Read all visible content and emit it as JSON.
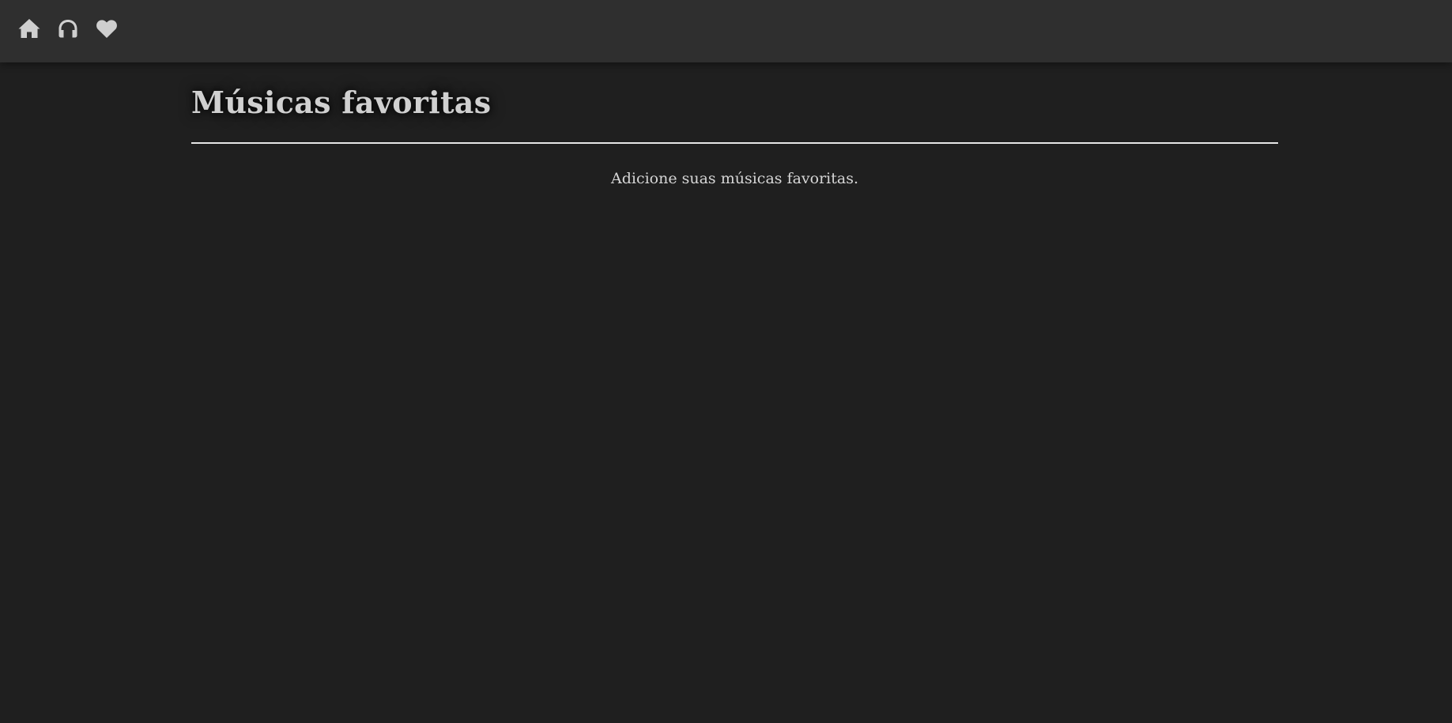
{
  "nav": {
    "items": [
      {
        "icon": "home-icon",
        "name": "nav-home"
      },
      {
        "icon": "headphones-icon",
        "name": "nav-search"
      },
      {
        "icon": "heart-icon",
        "name": "nav-favorites"
      }
    ]
  },
  "colors": {
    "background": "#1f1f1f",
    "header": "#2f2f2f",
    "text": "#d0d0d0",
    "icon": "#cfcfcf"
  },
  "main": {
    "title": "Músicas favoritas",
    "empty_message": "Adicione suas músicas favoritas."
  }
}
